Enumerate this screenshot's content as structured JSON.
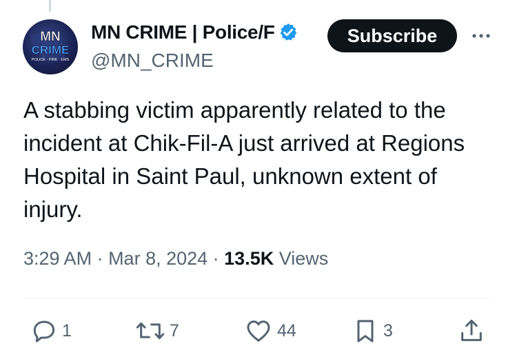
{
  "author": {
    "display_name": "MN CRIME | Police/F",
    "handle": "@MN_CRIME",
    "avatar_text": {
      "line1": "MN",
      "line2": "CRIME",
      "line3": "POLICE · FIRE · EMS"
    },
    "verified_icon": "verified-badge-icon"
  },
  "subscribe_label": "Subscribe",
  "more_icon": "more-options-icon",
  "tweet": {
    "text": "A stabbing victim apparently related to the incident at Chik-Fil-A just arrived at Regions Hospital in Saint Paul, unknown extent of injury."
  },
  "meta": {
    "time": "3:29 AM",
    "separator": " · ",
    "date": "Mar 8, 2024",
    "views_count": "13.5K",
    "views_label": " Views"
  },
  "actions": {
    "reply": {
      "icon": "reply-icon",
      "count": "1"
    },
    "repost": {
      "icon": "repost-icon",
      "count": "7"
    },
    "like": {
      "icon": "like-icon",
      "count": "44"
    },
    "bookmark": {
      "icon": "bookmark-icon",
      "count": "3"
    },
    "share": {
      "icon": "share-icon"
    }
  },
  "colors": {
    "text_primary": "#0f1419",
    "text_secondary": "#536471",
    "verified_blue": "#1d9bf0",
    "button_bg": "#0f1419",
    "divider": "#eff3f4"
  }
}
